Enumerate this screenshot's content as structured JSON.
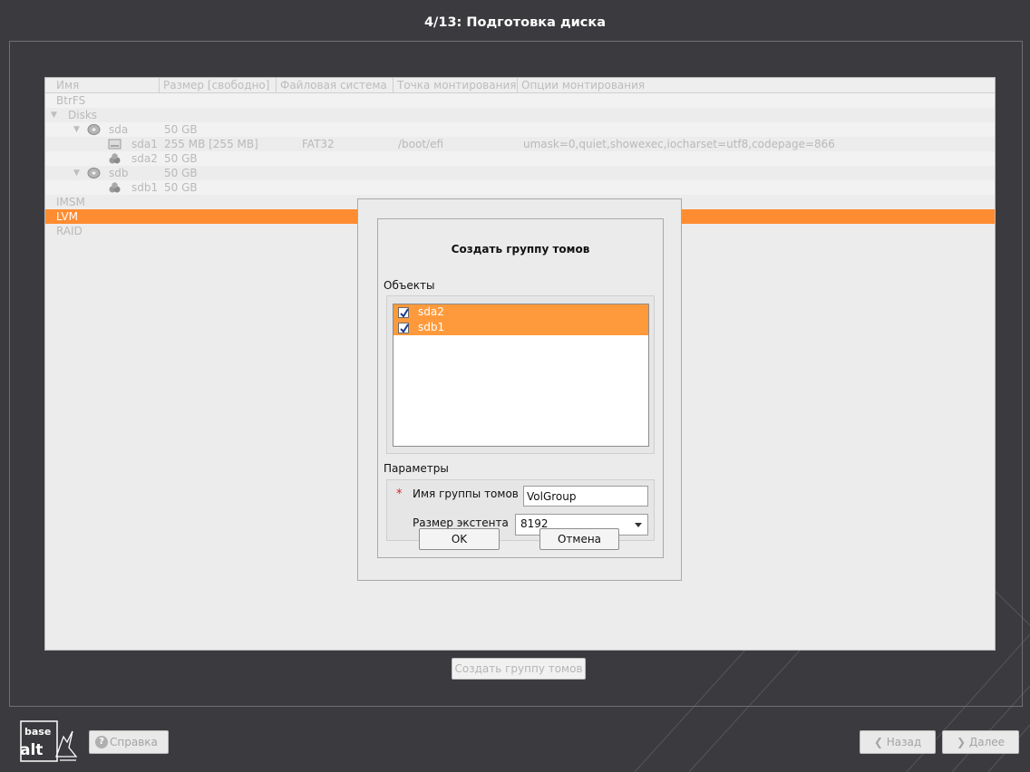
{
  "window": {
    "title": "4/13: Подготовка диска"
  },
  "tree": {
    "columns": [
      "Имя",
      "Размер [свободно]",
      "Файловая система",
      "Точка монтирования",
      "Опции монтирования"
    ],
    "rows": [
      {
        "name": "BtrFS",
        "size": "",
        "fs": "",
        "mount": "",
        "options": ""
      },
      {
        "name": "Disks",
        "size": "",
        "fs": "",
        "mount": "",
        "options": ""
      },
      {
        "name": "sda",
        "size": "50 GB",
        "fs": "",
        "mount": "",
        "options": ""
      },
      {
        "name": "sda1",
        "size": "255 MB [255 MB]",
        "fs": "FAT32",
        "mount": "/boot/efi",
        "options": "umask=0,quiet,showexec,iocharset=utf8,codepage=866"
      },
      {
        "name": "sda2",
        "size": "50 GB",
        "fs": "",
        "mount": "",
        "options": ""
      },
      {
        "name": "sdb",
        "size": "50 GB",
        "fs": "",
        "mount": "",
        "options": ""
      },
      {
        "name": "sdb1",
        "size": "50 GB",
        "fs": "",
        "mount": "",
        "options": ""
      },
      {
        "name": "IMSM",
        "size": "",
        "fs": "",
        "mount": "",
        "options": ""
      },
      {
        "name": "LVM",
        "size": "",
        "fs": "",
        "mount": "",
        "options": ""
      },
      {
        "name": "RAID",
        "size": "",
        "fs": "",
        "mount": "",
        "options": ""
      }
    ],
    "selected": "LVM"
  },
  "dialog": {
    "title": "Создать группу томов",
    "objects_label": "Объекты",
    "objects": [
      {
        "label": "sda2",
        "checked": true
      },
      {
        "label": "sdb1",
        "checked": true
      }
    ],
    "params_label": "Параметры",
    "required_mark": "*",
    "vg_name_label": "Имя группы томов",
    "vg_name_value": "VolGroup",
    "extent_label": "Размер экстента",
    "extent_value": "8192",
    "ok_label": "OK",
    "cancel_label": "Отмена"
  },
  "create_vg_button": "Создать группу томов",
  "footer": {
    "logo_top": "base",
    "logo_bottom": "alt",
    "help_label": "Справка",
    "back_label": "Назад",
    "next_label": "Далее"
  },
  "colors": {
    "accent": "#ff8c30",
    "background": "#3b3b3f",
    "required": "#e0202a"
  },
  "icons": {
    "disk": "disk-icon",
    "partition": "partition-icon",
    "free_space": "free-space-icon",
    "help": "help-icon",
    "back": "chevron-left-icon",
    "next": "chevron-right-icon",
    "dropdown": "chevron-down-icon"
  }
}
